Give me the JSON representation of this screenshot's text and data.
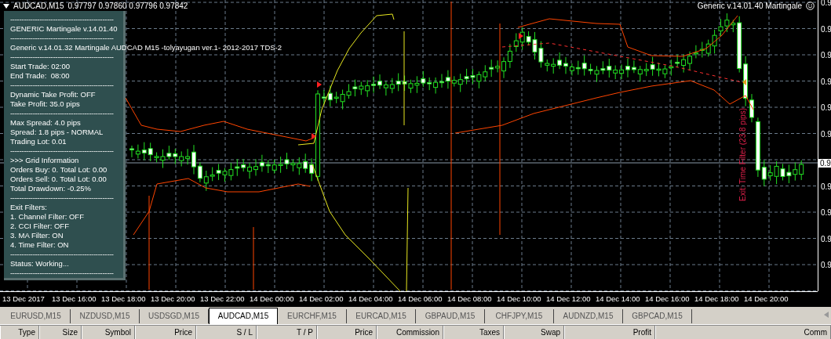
{
  "chart": {
    "header": {
      "symbol": "AUDCAD,M15",
      "quotes": "0.97797 0.97860 0.97796 0.97842"
    },
    "expert_name": "Generic v.14.01.40 Martingale",
    "info_panel": [
      {
        "kind": "separator",
        "text": "----------------------------------------------"
      },
      {
        "kind": "text",
        "text": "GENERIC Martingale v.14.01.40"
      },
      {
        "kind": "separator",
        "text": "----------------------------------------------"
      },
      {
        "kind": "text",
        "text": "Generic v.14.01.32 Martingale AUDCAD M15 -tolyayugan ver.1- 2012-2017 TDS-2"
      },
      {
        "kind": "separator",
        "text": "----------------------------------------------"
      },
      {
        "kind": "text",
        "text": "Start Trade: 02:00"
      },
      {
        "kind": "text",
        "text": "End Trade:  08:00"
      },
      {
        "kind": "separator",
        "text": "----------------------------------------------"
      },
      {
        "kind": "text",
        "text": "Dynamic Take Profit: OFF"
      },
      {
        "kind": "text",
        "text": "Take Profit: 35.0 pips"
      },
      {
        "kind": "separator",
        "text": "----------------------------------------------"
      },
      {
        "kind": "text",
        "text": "Max Spread: 4.0 pips"
      },
      {
        "kind": "text",
        "text": "Spread: 1.8 pips - NORMAL"
      },
      {
        "kind": "text",
        "text": "Trading Lot: 0.01"
      },
      {
        "kind": "separator",
        "text": "----------------------------------------------"
      },
      {
        "kind": "text",
        "text": ">>> Grid Information"
      },
      {
        "kind": "text",
        "text": "Orders Buy: 0. Total Lot: 0.00"
      },
      {
        "kind": "text",
        "text": "Orders Sell: 0. Total Lot: 0.00"
      },
      {
        "kind": "text",
        "text": "Total Drawdown: -0.25%"
      },
      {
        "kind": "separator",
        "text": "----------------------------------------------"
      },
      {
        "kind": "text",
        "text": "Exit Filters:"
      },
      {
        "kind": "text",
        "text": "1. Channel Filter: OFF"
      },
      {
        "kind": "text",
        "text": "2. CCI Filter: OFF"
      },
      {
        "kind": "text",
        "text": "3. MA Filter: ON"
      },
      {
        "kind": "text",
        "text": "4. Time Filter: ON"
      },
      {
        "kind": "separator",
        "text": "----------------------------------------------"
      },
      {
        "kind": "text",
        "text": "Status: Working..."
      },
      {
        "kind": "separator",
        "text": "----------------------------------------------"
      }
    ],
    "exit_label": "Exit: Time Filter (23.8 pips)",
    "price_labels": [
      {
        "text": "0.9",
        "kind": "tick"
      },
      {
        "text": "0.9",
        "kind": "tick"
      },
      {
        "text": "0.9",
        "kind": "tick"
      },
      {
        "text": "0.9",
        "kind": "tick"
      },
      {
        "text": "0.9",
        "kind": "tick"
      },
      {
        "text": "0.9",
        "kind": "tick"
      },
      {
        "text": "0.9",
        "kind": "current"
      },
      {
        "text": "0.9",
        "kind": "tick"
      },
      {
        "text": "0.9",
        "kind": "tick"
      },
      {
        "text": "0.9",
        "kind": "tick"
      },
      {
        "text": "0.9",
        "kind": "tick"
      }
    ],
    "time_labels": [
      "13 Dec 2017",
      "13 Dec 16:00",
      "13 Dec 18:00",
      "13 Dec 20:00",
      "13 Dec 22:00",
      "14 Dec 00:00",
      "14 Dec 02:00",
      "14 Dec 04:00",
      "14 Dec 06:00",
      "14 Dec 08:00",
      "14 Dec 10:00",
      "14 Dec 12:00",
      "14 Dec 14:00",
      "14 Dec 16:00",
      "14 Dec 18:00",
      "14 Dec 20:00"
    ]
  },
  "tabs": [
    {
      "label": "EURUSD,M15",
      "selected": false
    },
    {
      "label": "NZDUSD,M15",
      "selected": false
    },
    {
      "label": "USDSGD,M15",
      "selected": false
    },
    {
      "label": "AUDCAD,M15",
      "selected": true
    },
    {
      "label": "EURCHF,M15",
      "selected": false
    },
    {
      "label": "EURCAD,M15",
      "selected": false
    },
    {
      "label": "GBPAUD,M15",
      "selected": false
    },
    {
      "label": "CHFJPY,M15",
      "selected": false
    },
    {
      "label": "AUDNZD,M15",
      "selected": false
    },
    {
      "label": "GBPCAD,M15",
      "selected": false
    }
  ],
  "columns": [
    "Type",
    "Size",
    "Symbol",
    "Price",
    "S / L",
    "T / P",
    "Price",
    "Commission",
    "Taxes",
    "Swap",
    "Profit",
    "Comm"
  ]
}
